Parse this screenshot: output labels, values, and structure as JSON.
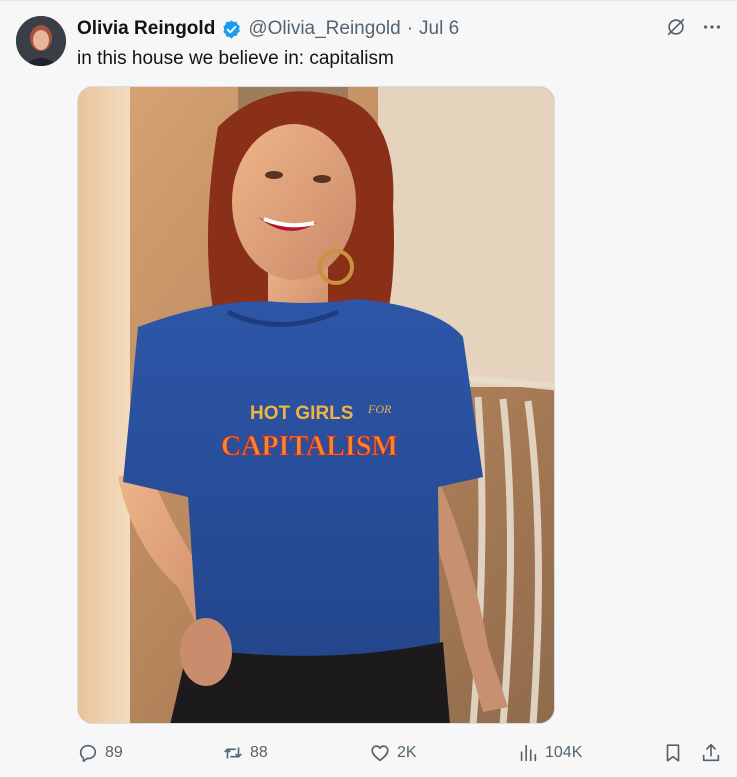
{
  "user": {
    "display_name": "Olivia Reingold",
    "handle": "@Olivia_Reingold",
    "separator": "·",
    "date": "Jul 6",
    "verified": true
  },
  "tweet": {
    "text": "in this house we believe in: capitalism"
  },
  "media": {
    "shirt_line1": "HOT GIRLS",
    "shirt_line1_script": "FOR",
    "shirt_line2": "CAPITALISM"
  },
  "actions": {
    "replies": "89",
    "reposts": "88",
    "likes": "2K",
    "views": "104K"
  },
  "colors": {
    "verified_blue": "#1d9bf0",
    "muted_text": "#536471",
    "shirt_blue": "#2b4f9c"
  },
  "icons": {
    "top": [
      "grok-icon",
      "more-icon"
    ],
    "bottom": [
      "reply-icon",
      "repost-icon",
      "like-icon",
      "views-icon",
      "bookmark-icon",
      "share-icon"
    ]
  }
}
